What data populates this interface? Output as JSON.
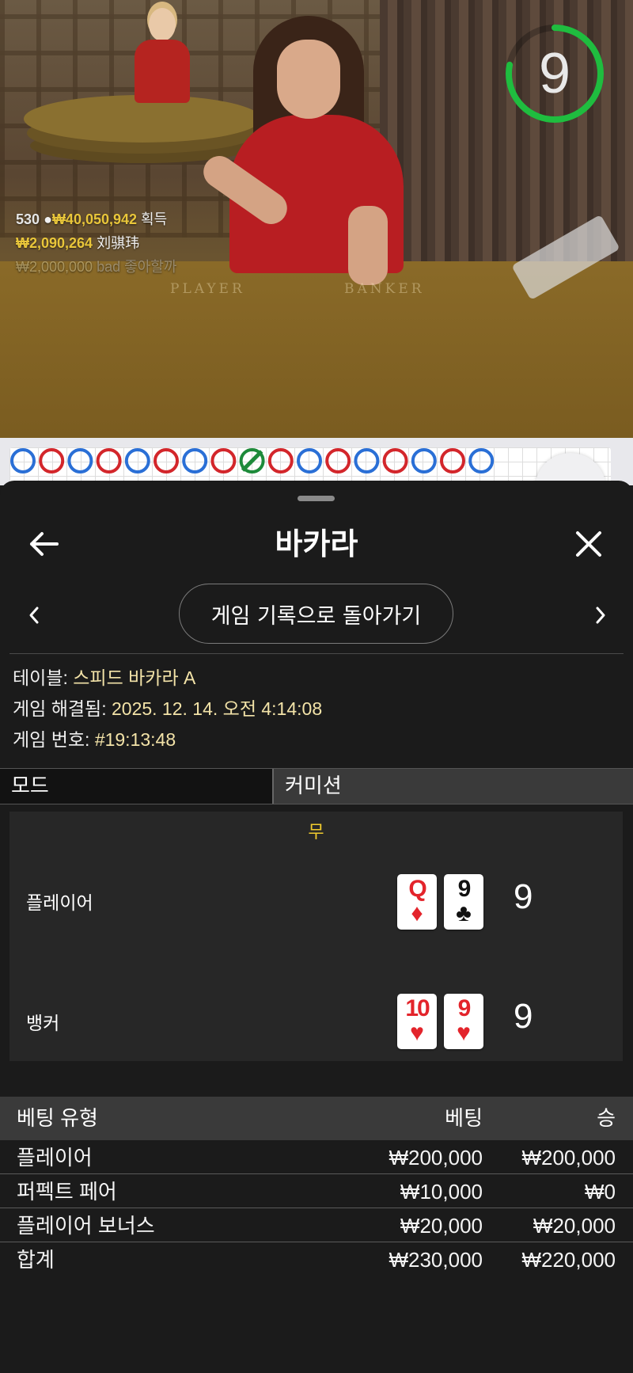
{
  "video": {
    "timer": "9",
    "timer_progress": 0.78,
    "felt_player": "PLAYER",
    "felt_banker": "BANKER",
    "feed": {
      "count": "530",
      "total": "₩40,050,942",
      "total_suffix": "획득",
      "win_amount": "₩2,090,264",
      "win_user": "刘骐玮",
      "faded_amount": "₩2,000,000",
      "faded_text": "bad 좋아할까"
    }
  },
  "roadmap": {
    "top_row": [
      "blue",
      "red",
      "blue",
      "red",
      "blue",
      "red",
      "blue",
      "red",
      "green",
      "red",
      "blue",
      "red",
      "blue",
      "red",
      "blue",
      "red",
      "blue"
    ]
  },
  "sheet": {
    "title": "바카라",
    "return_label": "게임 기록으로 돌아가기",
    "info": {
      "table_label": "테이블:",
      "table_value": "스피드 바카라 A",
      "resolved_label": "게임 해결됨:",
      "resolved_value": "2025. 12. 14. 오전 4:14:08",
      "number_label": "게임 번호:",
      "number_value": "#19:13:48"
    },
    "tabs": {
      "mode": "모드",
      "commission": "커미션"
    },
    "result": {
      "outcome": "무",
      "player_label": "플레이어",
      "banker_label": "뱅커",
      "player_cards": [
        {
          "rank": "Q",
          "suit": "♦",
          "color": "red"
        },
        {
          "rank": "9",
          "suit": "♣",
          "color": "black"
        }
      ],
      "banker_cards": [
        {
          "rank": "10",
          "suit": "♥",
          "color": "red"
        },
        {
          "rank": "9",
          "suit": "♥",
          "color": "red"
        }
      ],
      "player_score": "9",
      "banker_score": "9"
    },
    "bets": {
      "headers": {
        "type": "베팅 유형",
        "bet": "베팅",
        "win": "승"
      },
      "rows": [
        {
          "type": "플레이어",
          "bet": "₩200,000",
          "win": "₩200,000"
        },
        {
          "type": "퍼펙트 페어",
          "bet": "₩10,000",
          "win": "₩0"
        },
        {
          "type": "플레이어 보너스",
          "bet": "₩20,000",
          "win": "₩20,000"
        },
        {
          "type": "합계",
          "bet": "₩230,000",
          "win": "₩220,000"
        }
      ]
    }
  },
  "colors": {
    "accent_gold": "#f2cc2e",
    "timer_green": "#1fbd3f",
    "value_cream": "#f3e3a8"
  }
}
